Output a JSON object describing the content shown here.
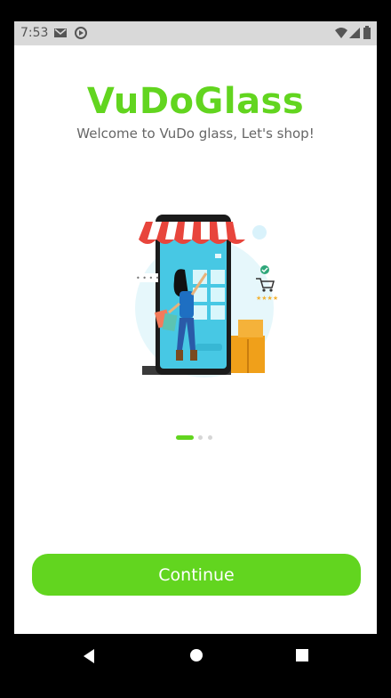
{
  "status_bar": {
    "time": "7:53"
  },
  "app": {
    "brand": "VuDoGlass",
    "tagline": "Welcome to VuDo glass, Let's shop!"
  },
  "carousel": {
    "page_count": 3,
    "active_index": 0
  },
  "actions": {
    "continue_label": "Continue"
  },
  "colors": {
    "accent": "#62d51f",
    "dot_inactive": "#d6d6d6"
  },
  "icons": {
    "status_left": [
      "gmail-icon",
      "sync-icon"
    ],
    "status_right": [
      "wifi-icon",
      "signal-icon",
      "battery-icon"
    ],
    "nav": [
      "back-icon",
      "home-icon",
      "recents-icon"
    ]
  }
}
